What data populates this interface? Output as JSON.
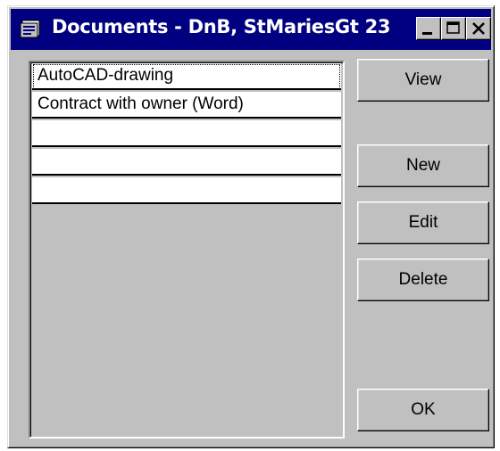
{
  "window": {
    "title": "Documents - DnB, StMariesGt 23",
    "icon": "document-window-icon",
    "controls": [
      "minimize-icon",
      "maximize-icon",
      "close-icon"
    ]
  },
  "documents": {
    "items": [
      "AutoCAD-drawing",
      "Contract with owner (Word)",
      "",
      "",
      ""
    ]
  },
  "buttons": {
    "view": "View",
    "new": "New",
    "edit": "Edit",
    "delete": "Delete",
    "ok": "OK"
  },
  "colors": {
    "titlebar": "#000080",
    "face": "#c0c0c0",
    "list_bg": "#ffffff"
  }
}
